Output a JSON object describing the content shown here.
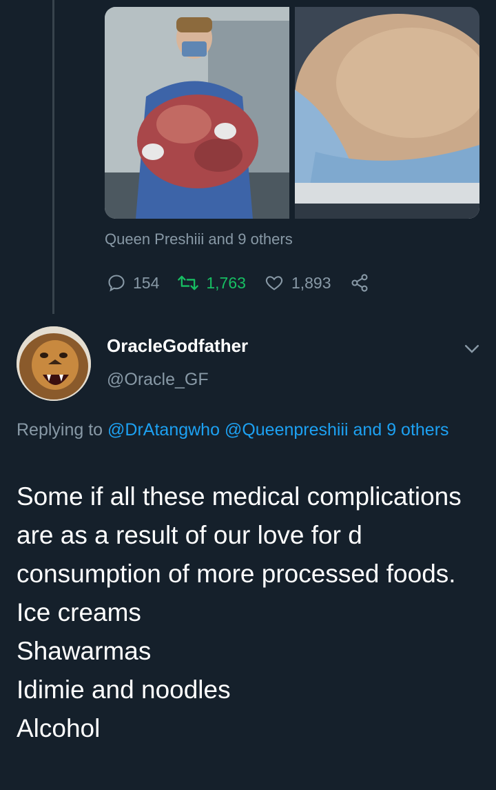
{
  "parent_tweet": {
    "media": [
      {
        "icon": "surgeon-holding-tumor-photo"
      },
      {
        "icon": "swollen-abdomen-photo"
      }
    ],
    "replies_context": "Queen Preshiii and 9 others",
    "stats": {
      "replies": "154",
      "retweets": "1,763",
      "likes": "1,893"
    }
  },
  "reply_tweet": {
    "display_name": "OracleGodfather",
    "handle": "@Oracle_GF",
    "avatar_icon": "lion-avatar",
    "replying_prefix": "Replying to",
    "mentions": [
      "@DrAtangwho",
      "@Queenpreshiii"
    ],
    "and_others": "and 9 others",
    "text": "Some if all these medical complications are as a result of our love for d consumption of more processed foods.\nIce creams\nShawarmas\nIdimie and noodles\nAlcohol"
  },
  "colors": {
    "background": "#15202b",
    "secondary_text": "#8899a6",
    "link": "#1da1f2",
    "retweet_green": "#17bf63",
    "thread_line": "#38444d"
  }
}
